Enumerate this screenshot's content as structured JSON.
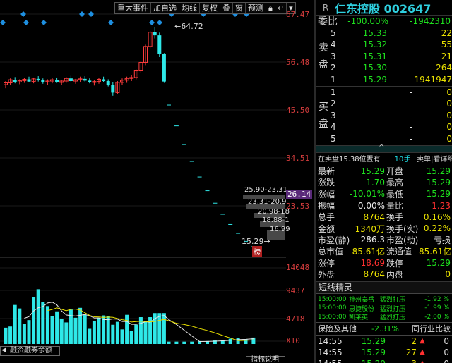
{
  "toolbar": [
    "重大事件",
    "加自选",
    "均线",
    "复权",
    "叠",
    "窗",
    "预测",
    "锁-icon",
    "返回-icon",
    "下拉-icon"
  ],
  "price_axis": [
    "67.47",
    "56.48",
    "45.50",
    "34.51",
    "26.14",
    "23.53",
    "14048",
    "9437",
    "4718",
    "X10"
  ],
  "chart_labels": {
    "high": "64.72",
    "low": "15.29",
    "bang": "榜",
    "margin": "融资融券余额",
    "level_labels": [
      "25.90-23.31",
      "23.31-20.9",
      "20.98-18",
      "18.88-1",
      "16.99"
    ]
  },
  "header": {
    "prefix": "R",
    "name": "仁东控股 002647"
  },
  "weibi": {
    "label": "委比",
    "pct": "-100.00%",
    "diff": "-1942310"
  },
  "sell": {
    "side_label": [
      "卖",
      "盘"
    ],
    "rows": [
      {
        "n": "5",
        "price": "15.33",
        "vol": "22"
      },
      {
        "n": "4",
        "price": "15.32",
        "vol": "55"
      },
      {
        "n": "3",
        "price": "15.31",
        "vol": "21"
      },
      {
        "n": "2",
        "price": "15.30",
        "vol": "264"
      },
      {
        "n": "1",
        "price": "15.29",
        "vol": "1941947"
      }
    ]
  },
  "buy": {
    "side_label": [
      "买",
      "盘"
    ],
    "rows": [
      {
        "n": "1",
        "price": "-",
        "vol": "0"
      },
      {
        "n": "2",
        "price": "-",
        "vol": "0"
      },
      {
        "n": "3",
        "price": "-",
        "vol": "0"
      },
      {
        "n": "4",
        "price": "-",
        "vol": "0"
      },
      {
        "n": "5",
        "price": "-",
        "vol": "0"
      }
    ]
  },
  "sell_hint": {
    "text": "在卖盘15.38位置有",
    "hand": "10手",
    "action": "卖单|看详细"
  },
  "quote": [
    {
      "l1": "最新",
      "v1": "15.29",
      "l2": "开盘",
      "v2": "15.29"
    },
    {
      "l1": "涨跌",
      "v1": "-1.70",
      "l2": "最高",
      "v2": "15.29"
    },
    {
      "l1": "涨幅",
      "v1": "-10.01%",
      "l2": "最低",
      "v2": "15.29"
    },
    {
      "l1": "振幅",
      "v1": "0.00%",
      "l2": "量比",
      "v2": "1.23"
    },
    {
      "l1": "总手",
      "v1": "8764",
      "l2": "换手",
      "v2": "0.16%"
    },
    {
      "l1": "金额",
      "v1": "1340万",
      "l2": "换手(实)",
      "v2": "0.22%"
    },
    {
      "l1": "市盈(静)",
      "v1": "286.3",
      "l2": "市盈(动)",
      "v2": "亏损"
    },
    {
      "l1": "总市值",
      "v1": "85.61亿",
      "l2": "流通值",
      "v2": "85.61亿"
    },
    {
      "l1": "涨停",
      "v1": "18.69",
      "l2": "跌停",
      "v2": "15.29"
    },
    {
      "l1": "外盘",
      "v1": "8764",
      "l2": "内盘",
      "v2": "0"
    }
  ],
  "elves": {
    "title": "短线精灵",
    "rows": [
      {
        "time": "15:00:00",
        "name": "神州泰岳",
        "event": "猛烈打压",
        "pct": "-1.92 %"
      },
      {
        "time": "15:00:00",
        "name": "思捷股份",
        "event": "猛烈打压",
        "pct": "-1.99 %"
      },
      {
        "time": "15:00:00",
        "name": "凯莱英",
        "event": "猛烈打压",
        "pct": "-2.00 %"
      }
    ]
  },
  "sector": {
    "name": "保险及其他",
    "pct": "-2.31%",
    "compare": "同行业比较"
  },
  "ticks": [
    {
      "time": "14:55",
      "price": "15.29",
      "vol": "2"
    },
    {
      "time": "14:55",
      "price": "15.29",
      "vol": "27"
    },
    {
      "time": "14:55",
      "price": "15.29",
      "vol": "3"
    },
    {
      "time": "14:55",
      "price": "15.29",
      "vol": "2"
    }
  ],
  "bottom_tab": "指标说明",
  "chart_data": {
    "type": "candlestick",
    "ylim": [
      14.5,
      68
    ],
    "candles": [
      [
        51.8,
        52.6,
        51.0,
        52.2
      ],
      [
        52.2,
        53.2,
        51.8,
        52.9
      ],
      [
        52.9,
        53.5,
        52.1,
        52.4
      ],
      [
        52.4,
        53.0,
        51.9,
        52.7
      ],
      [
        52.7,
        53.3,
        52.2,
        53.0
      ],
      [
        53.0,
        53.6,
        52.3,
        52.5
      ],
      [
        52.5,
        53.4,
        52.1,
        53.1
      ],
      [
        53.1,
        53.7,
        52.5,
        52.8
      ],
      [
        52.8,
        53.2,
        52.0,
        52.4
      ],
      [
        52.4,
        53.0,
        51.8,
        52.6
      ],
      [
        52.6,
        53.3,
        52.1,
        52.9
      ],
      [
        52.9,
        53.4,
        52.2,
        52.3
      ],
      [
        52.3,
        52.9,
        51.7,
        52.6
      ],
      [
        52.6,
        53.5,
        52.2,
        53.2
      ],
      [
        53.2,
        53.8,
        52.4,
        52.6
      ],
      [
        52.6,
        53.1,
        52.0,
        52.9
      ],
      [
        52.9,
        53.6,
        52.4,
        53.1
      ],
      [
        53.1,
        53.7,
        52.5,
        52.7
      ],
      [
        52.7,
        53.2,
        52.1,
        52.3
      ],
      [
        52.3,
        52.9,
        51.6,
        52.5
      ],
      [
        52.5,
        53.3,
        52.0,
        53.0
      ],
      [
        53.0,
        53.6,
        52.4,
        52.6
      ],
      [
        52.6,
        53.0,
        51.4,
        51.8
      ],
      [
        51.8,
        52.4,
        49.3,
        50.0
      ],
      [
        50.0,
        52.6,
        49.6,
        52.3
      ],
      [
        52.3,
        53.2,
        51.7,
        52.8
      ],
      [
        52.8,
        53.6,
        52.2,
        53.2
      ],
      [
        53.2,
        53.9,
        52.6,
        53.4
      ],
      [
        53.4,
        55.2,
        53.0,
        54.9
      ],
      [
        54.9,
        57.2,
        54.5,
        56.8
      ],
      [
        56.8,
        60.8,
        56.2,
        60.4
      ],
      [
        60.4,
        63.9,
        60.0,
        63.6
      ],
      [
        63.6,
        64.72,
        62.2,
        62.9
      ],
      [
        62.9,
        63.5,
        58.0,
        58.7
      ],
      [
        58.7,
        58.9,
        52.2,
        52.5
      ],
      [
        47.2,
        47.2,
        47.2,
        47.2
      ],
      [
        42.5,
        42.5,
        42.5,
        42.5
      ],
      [
        38.3,
        38.3,
        38.3,
        38.3
      ],
      [
        34.5,
        34.5,
        34.5,
        34.5
      ],
      [
        31.0,
        31.0,
        31.0,
        31.0
      ],
      [
        27.9,
        27.9,
        27.9,
        27.9
      ],
      [
        25.1,
        25.1,
        25.1,
        25.1
      ],
      [
        22.6,
        22.6,
        22.6,
        22.6
      ],
      [
        20.3,
        20.3,
        20.3,
        20.3
      ],
      [
        18.3,
        18.3,
        18.3,
        18.3
      ],
      [
        16.5,
        16.5,
        16.5,
        16.5
      ],
      [
        15.29,
        15.29,
        15.29,
        15.29
      ]
    ],
    "volume": [
      2.8,
      3.0,
      6.7,
      6.1,
      3.5,
      4.1,
      8.0,
      9.4,
      7.2,
      6.5,
      4.8,
      5.6,
      4.3,
      3.7,
      5.9,
      4.5,
      6.2,
      5.0,
      2.6,
      4.0,
      4.5,
      4.9,
      4.8,
      3.3,
      3.8,
      2.5,
      5.0,
      2.3,
      3.3,
      4.6,
      3.9,
      4.6,
      5.3,
      5.3,
      5.3,
      0.4,
      0.4,
      0.4,
      0.4,
      0.5,
      0.5,
      0.6,
      0.7,
      0.9,
      1.0,
      0.8,
      1.1
    ],
    "volume_ylim": [
      0,
      14048
    ]
  }
}
